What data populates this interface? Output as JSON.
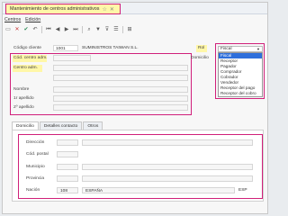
{
  "window": {
    "tab_title": "Mantenimiento de centros administrativos",
    "menu": [
      "Centros",
      "Edición"
    ]
  },
  "toolbar": {
    "icons": [
      "file-icon",
      "close-icon",
      "check-icon",
      "undo-icon",
      "first-icon",
      "prev-icon",
      "next-icon",
      "last-icon",
      "search-icon",
      "filter-icon",
      "filter-clear-icon",
      "list-icon",
      "grid-icon"
    ]
  },
  "form": {
    "codigo_cliente_label": "Código cliente",
    "codigo_cliente_value": "1001",
    "cliente_nombre": "SUMINISTROS TAIWAN S.L.",
    "cod_centro_label": "Cód. centro adm.",
    "centro_label": "Centro adm.",
    "nombre_label": "Nombre",
    "apellido1_label": "1r apellido",
    "apellido2_label": "2º apellido",
    "rol_label": "Rol",
    "domicilio_label": "Domicilio"
  },
  "rol_dropdown": {
    "selected": "Fiscal",
    "options": [
      "Fiscal",
      "Receptor",
      "Pagador",
      "Comprador",
      "Cobrador",
      "Vendedor",
      "Receptor del pago",
      "Receptor del cobro"
    ]
  },
  "subtabs": [
    "Domicilio",
    "Detalles contacto",
    "Otros"
  ],
  "address": {
    "direccion_label": "Dirección",
    "cod_postal_label": "Cód. postal",
    "municipio_label": "Municipio",
    "provincia_label": "Provincia",
    "nacion_label": "Nación",
    "nacion_code": "108",
    "nacion_name": "ESPAÑA",
    "nacion_iso": "ESP"
  },
  "colors": {
    "highlight_border": "#d0207a",
    "highlight_fill": "#fff7a8",
    "dropdown_selected": "#2f6fdb"
  }
}
